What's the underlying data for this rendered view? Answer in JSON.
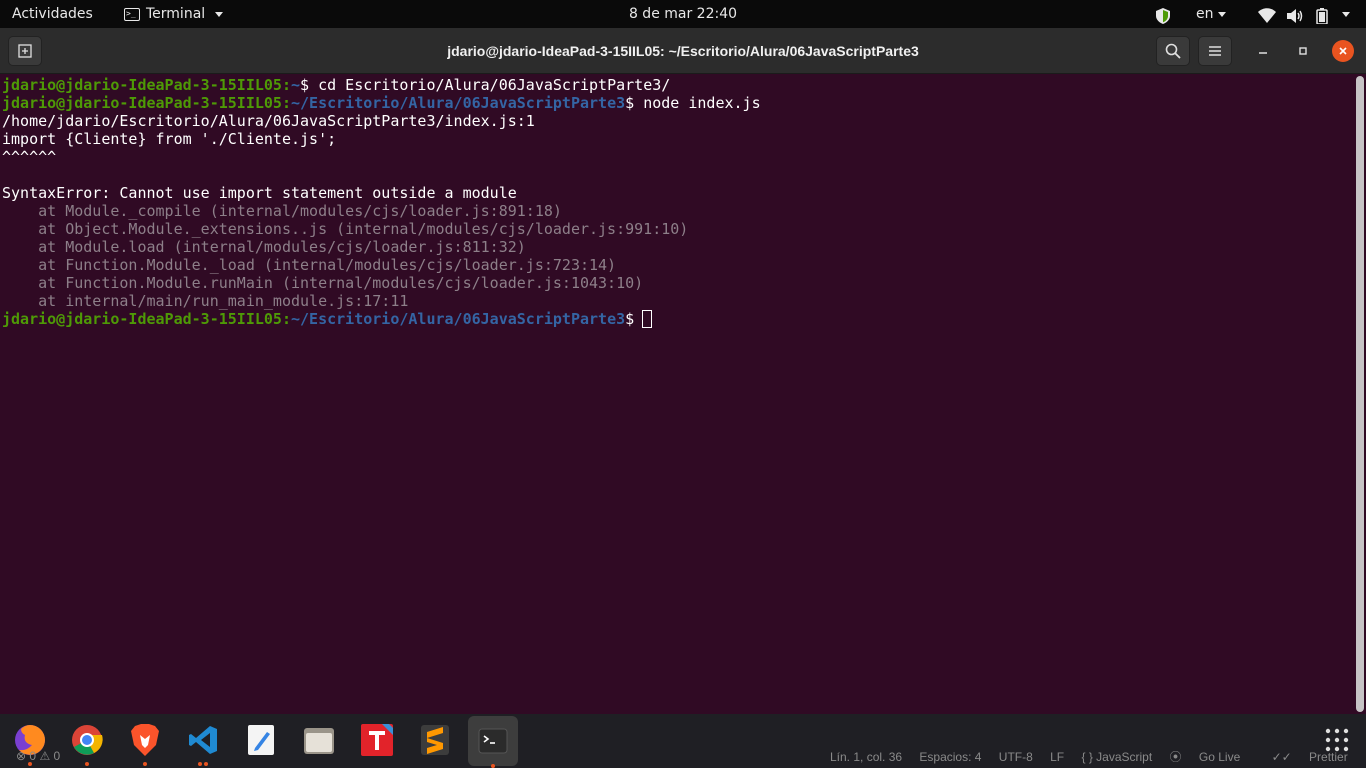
{
  "topbar": {
    "activities": "Actividades",
    "app_name": "Terminal",
    "clock": "8 de mar  22:40",
    "language": "en"
  },
  "window": {
    "title": "jdario@jdario-IdeaPad-3-15IIL05: ~/Escritorio/Alura/06JavaScriptParte3"
  },
  "terminal": {
    "prompt_user": "jdario@jdario-IdeaPad-3-15IIL05",
    "home_path": "~",
    "cwd_path": "~/Escritorio/Alura/06JavaScriptParte3",
    "cmd1": "$ cd Escritorio/Alura/06JavaScriptParte3/",
    "cmd2": "$ node index.js",
    "out_file": "/home/jdario/Escritorio/Alura/06JavaScriptParte3/index.js:1",
    "out_import": "import {Cliente} from './Cliente.js';",
    "out_carets": "^^^^^^",
    "out_error": "SyntaxError: Cannot use import statement outside a module",
    "stack": [
      "    at Module._compile (internal/modules/cjs/loader.js:891:18)",
      "    at Object.Module._extensions..js (internal/modules/cjs/loader.js:991:10)",
      "    at Module.load (internal/modules/cjs/loader.js:811:32)",
      "    at Function.Module._load (internal/modules/cjs/loader.js:723:14)",
      "    at Function.Module.runMain (internal/modules/cjs/loader.js:1043:10)",
      "    at internal/main/run_main_module.js:17:11"
    ],
    "final_prompt_suffix": "$"
  },
  "statusbar": {
    "problems": "0",
    "warnings": "0",
    "position": "Lín. 1, col. 36",
    "spaces": "Espacios: 4",
    "encoding": "UTF-8",
    "eol": "LF",
    "language": "{ } JavaScript",
    "golive": "Go Live",
    "prettier": "Prettier"
  },
  "dock": {
    "apps": [
      "firefox-icon",
      "chrome-icon",
      "brave-icon",
      "vscode-icon",
      "text-editor-icon",
      "files-icon",
      "typora-icon",
      "sublime-icon",
      "terminal-icon"
    ]
  },
  "colors": {
    "terminal_bg": "#300a24",
    "prompt_user": "#4e9a06",
    "prompt_path": "#3465a4",
    "close_button": "#e95420"
  }
}
